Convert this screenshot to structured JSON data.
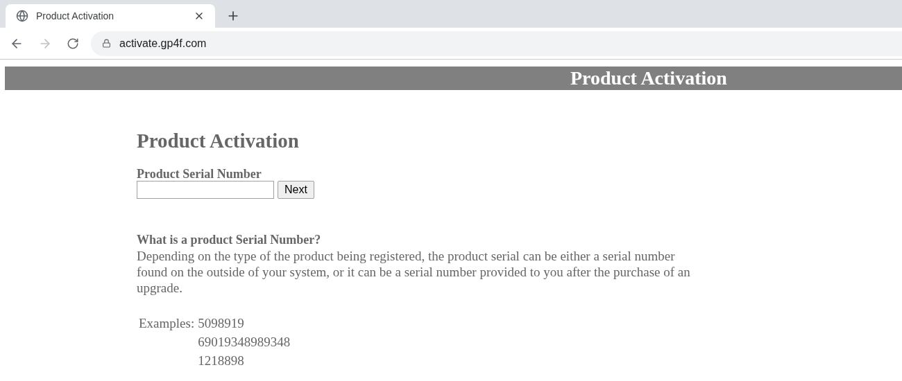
{
  "browser": {
    "tab_title": "Product Activation",
    "url": "activate.gp4f.com"
  },
  "banner": {
    "title": "Product Activation"
  },
  "heading": "Product Activation",
  "form": {
    "label": "Product Serial Number",
    "button": "Next"
  },
  "help": {
    "question": "What is a product Serial Number?",
    "answer": "Depending on the type of the product being registered, the product serial can be either a serial number found on the outside of your system, or it can be a serial number provided to you after the purchase of an upgrade.",
    "examples_label": "Examples:",
    "examples": [
      "5098919",
      "69019348989348",
      "1218898"
    ]
  }
}
